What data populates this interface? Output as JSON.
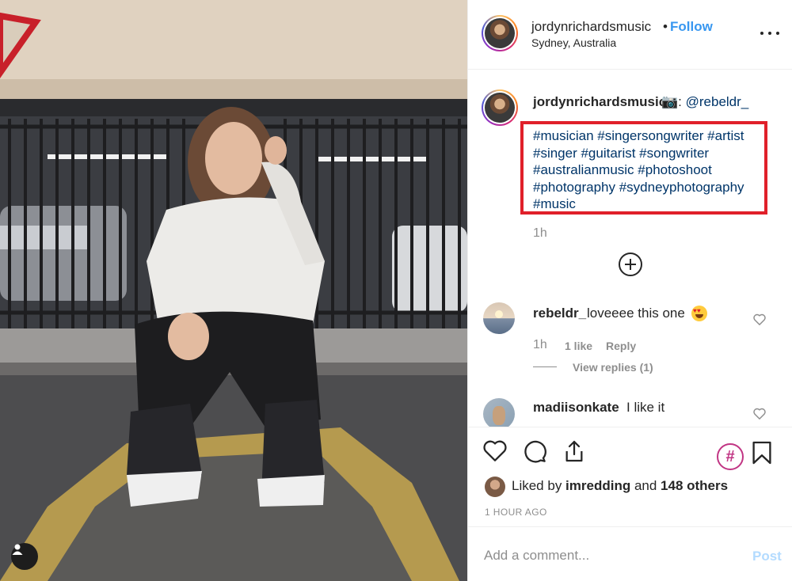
{
  "header": {
    "username": "jordynrichardsmusic",
    "separator": "•",
    "follow_label": "Follow",
    "location": "Sydney, Australia"
  },
  "caption": {
    "username": "jordynrichardsmusic",
    "text_prefix": "📷: ",
    "mention": "@rebeldr_",
    "hashtags": "#musician #singersongwriter #artist #singer #guitarist #songwriter #australianmusic #photoshoot #photography #sydneyphotography #music",
    "time": "1h"
  },
  "comments": [
    {
      "username": "rebeldr_",
      "text": "loveeee this one",
      "time": "1h",
      "likes": "1 like",
      "reply_label": "Reply",
      "view_replies": "View replies (1)"
    },
    {
      "username": "madiisonkate",
      "text": "I like it"
    }
  ],
  "actions": {
    "liked_prefix": "Liked by ",
    "liked_user": "imredding",
    "liked_mid": " and ",
    "liked_others": "148 others",
    "time_ago": "1 HOUR AGO",
    "hashtag_symbol": "#"
  },
  "add_comment": {
    "placeholder": "Add a comment...",
    "post_label": "Post"
  },
  "colors": {
    "link_blue": "#3897f0",
    "hashtag_blue": "#003569",
    "highlight_red": "#e0202a",
    "muted_gray": "#8e8e8e",
    "post_disabled": "#b3dbff"
  }
}
